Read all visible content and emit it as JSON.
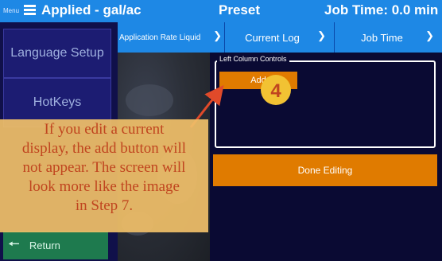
{
  "header": {
    "menu_label": "Menu",
    "applied": "Applied - gal/ac",
    "preset": "Preset",
    "job_time": "Job Time: 0.0 min"
  },
  "sidebar": {
    "items": [
      {
        "label": "Language Setup"
      },
      {
        "label": "HotKeys"
      }
    ],
    "return_label": "Return"
  },
  "dropdowns": {
    "application_rate": "Application Rate Liquid",
    "current_log": "Current Log",
    "job_time": "Job Time"
  },
  "panel": {
    "group_label": "Left Column Controls",
    "add_button": "Add",
    "done_button": "Done Editing"
  },
  "annotation": {
    "step_badge": "4",
    "note": "If you edit a current\ndisplay, the add button will\nnot appear. The screen will\nlook more like the image\nin  Step 7."
  },
  "colors": {
    "header_blue": "#1e88e5",
    "background": "#0a0a33",
    "orange": "#e07b00",
    "green": "#1e7a4e",
    "callout": "#efbe68",
    "callout_text": "#c0451f"
  }
}
